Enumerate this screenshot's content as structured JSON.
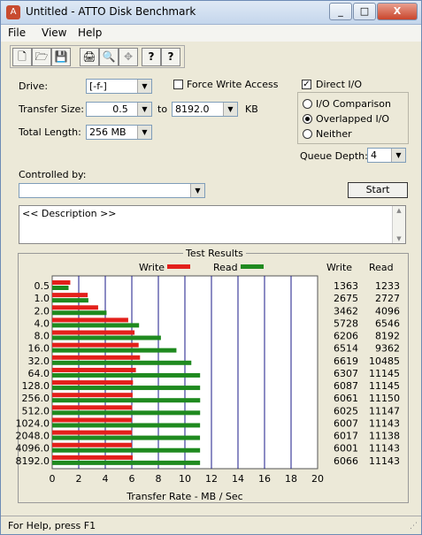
{
  "window": {
    "title": "Untitled - ATTO Disk Benchmark",
    "minimize": "_",
    "maximize": "□",
    "close": "X"
  },
  "menu": {
    "file": "File",
    "view": "View",
    "help": "Help"
  },
  "toolbar": {
    "new": "🗋",
    "open": "🗁",
    "save": "💾",
    "print": "🖨",
    "preview": "🔍",
    "move": "✥",
    "help": "?",
    "whats_this": "?"
  },
  "form": {
    "drive_label": "Drive:",
    "drive_value": "[-f-]",
    "force_write_label": "Force Write Access",
    "direct_io_label": "Direct I/O",
    "transfer_size_label": "Transfer Size:",
    "transfer_from": "0.5",
    "to_label": "to",
    "transfer_to": "8192.0",
    "kb_label": "KB",
    "total_length_label": "Total Length:",
    "total_length_value": "256 MB",
    "io_comparison_label": "I/O Comparison",
    "overlapped_io_label": "Overlapped I/O",
    "neither_label": "Neither",
    "queue_depth_label": "Queue Depth:",
    "queue_depth_value": "4",
    "controlled_by_label": "Controlled by:",
    "controlled_by_value": "",
    "start_label": "Start",
    "description_placeholder": "<< Description >>"
  },
  "results": {
    "title": "Test Results",
    "write_legend": "Write",
    "read_legend": "Read",
    "write_col": "Write",
    "read_col": "Read"
  },
  "status": {
    "text": "For Help, press F1"
  },
  "chart_data": {
    "type": "bar",
    "orientation": "horizontal",
    "xlabel": "Transfer Rate - MB / Sec",
    "xlim": [
      0,
      20
    ],
    "xticks": [
      "0",
      "2",
      "4",
      "6",
      "8",
      "10",
      "12",
      "14",
      "16",
      "18",
      "20"
    ],
    "categories": [
      "0.5",
      "1.0",
      "2.0",
      "4.0",
      "8.0",
      "16.0",
      "32.0",
      "64.0",
      "128.0",
      "256.0",
      "512.0",
      "1024.0",
      "2048.0",
      "4096.0",
      "8192.0"
    ],
    "series": [
      {
        "name": "Write",
        "color": "#e3201b",
        "values": [
          1.363,
          2.675,
          3.462,
          5.728,
          6.206,
          6.514,
          6.619,
          6.307,
          6.087,
          6.061,
          6.025,
          6.007,
          6.017,
          6.001,
          6.066
        ],
        "labels": [
          "1363",
          "2675",
          "3462",
          "5728",
          "6206",
          "6514",
          "6619",
          "6307",
          "6087",
          "6061",
          "6025",
          "6007",
          "6017",
          "6001",
          "6066"
        ]
      },
      {
        "name": "Read",
        "color": "#1f8a1f",
        "values": [
          1.233,
          2.727,
          4.096,
          6.546,
          8.192,
          9.362,
          10.485,
          11.145,
          11.145,
          11.15,
          11.147,
          11.143,
          11.138,
          11.143,
          11.143
        ],
        "labels": [
          "1233",
          "2727",
          "4096",
          "6546",
          "8192",
          "9362",
          "10485",
          "11145",
          "11145",
          "11150",
          "11147",
          "11143",
          "11138",
          "11143",
          "11143"
        ]
      }
    ]
  }
}
